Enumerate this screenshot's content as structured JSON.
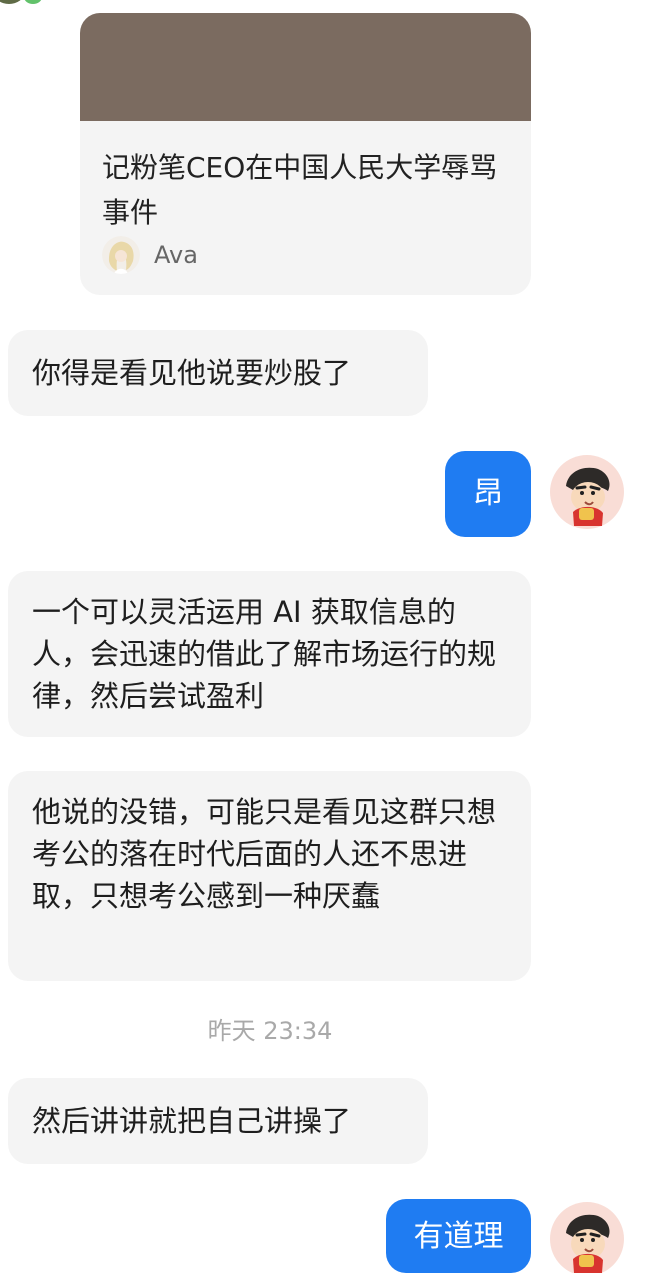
{
  "share_card": {
    "title": "记粉笔CEO在中国人民大学辱骂事件",
    "author_name": "Ava",
    "image_color": "#7b6b60"
  },
  "messages": [
    {
      "side": "left",
      "text": "你得是看见他说要炒股了"
    },
    {
      "side": "right",
      "text": "昂"
    },
    {
      "side": "left",
      "text": "一个可以灵活运用 AI 获取信息的人，会迅速的借此了解市场运行的规律，然后尝试盈利"
    },
    {
      "side": "left",
      "text": "他说的没错，可能只是看见这群只想考公的落在时代后面的人还不思进取，只想考公感到一种厌蠢"
    },
    {
      "side": "left",
      "text": "然后讲讲就把自己讲操了"
    },
    {
      "side": "right",
      "text": "有道理"
    }
  ],
  "timestamp": "昨天 23:34",
  "icons": {
    "self_avatar": "cartoon-boy-avatar-icon",
    "author_avatar": "blonde-woman-avatar-icon"
  },
  "colors": {
    "bubble_left": "#f4f4f4",
    "bubble_right": "#1f7cf2",
    "timestamp": "#a9a9a9"
  }
}
